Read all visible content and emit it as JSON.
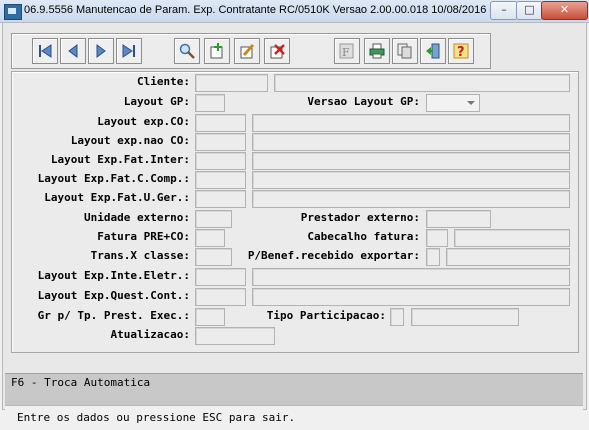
{
  "window": {
    "title": "06.9.5556 Manutencao  de Param. Exp. Contratante RC/0510K Versao 2.00.00.018 10/08/2016 - ...",
    "minimize_label": "–",
    "maximize_label": "□",
    "close_label": "✕"
  },
  "toolbar": {
    "buttons": [
      {
        "name": "first-record-icon"
      },
      {
        "name": "previous-record-icon"
      },
      {
        "name": "next-record-icon"
      },
      {
        "name": "last-record-icon"
      },
      {
        "name": "search-icon"
      },
      {
        "name": "add-record-icon"
      },
      {
        "name": "edit-record-icon"
      },
      {
        "name": "delete-record-icon"
      },
      {
        "name": "filter-icon"
      },
      {
        "name": "print-icon"
      },
      {
        "name": "copy-icon"
      },
      {
        "name": "exit-icon"
      },
      {
        "name": "help-icon"
      }
    ]
  },
  "form": {
    "cliente": "Cliente:",
    "layout_gp": "Layout GP:",
    "versao_layout_gp": "Versao Layout GP:",
    "layout_exp_co": "Layout exp.CO:",
    "layout_exp_nao_co": "Layout exp.nao CO:",
    "layout_exp_fat_inter": "Layout Exp.Fat.Inter:",
    "layout_exp_fat_c_comp": "Layout Exp.Fat.C.Comp.:",
    "layout_exp_fat_u_ger": "Layout Exp.Fat.U.Ger.:",
    "unidade_externo": "Unidade externo:",
    "prestador_externo": "Prestador externo:",
    "fatura_pre_co": "Fatura PRE+CO:",
    "cabecalho_fatura": "Cabecalho fatura:",
    "trans_x_classe": "Trans.X classe:",
    "p_benef_recebido_exportar": "P/Benef.recebido exportar:",
    "layout_exp_inte_eletr": "Layout Exp.Inte.Eletr.:",
    "layout_exp_quest_cont": "Layout Exp.Quest.Cont.:",
    "gr_p_tp_prest_exec": "Gr p/ Tp. Prest. Exec.:",
    "tipo_participacao": "Tipo Participacao:",
    "atualizacao": "Atualizacao:"
  },
  "fkey_bar": {
    "text": "F6 - Troca Automatica"
  },
  "status_bar": {
    "text": "Entre os dados ou pressione ESC para sair."
  }
}
